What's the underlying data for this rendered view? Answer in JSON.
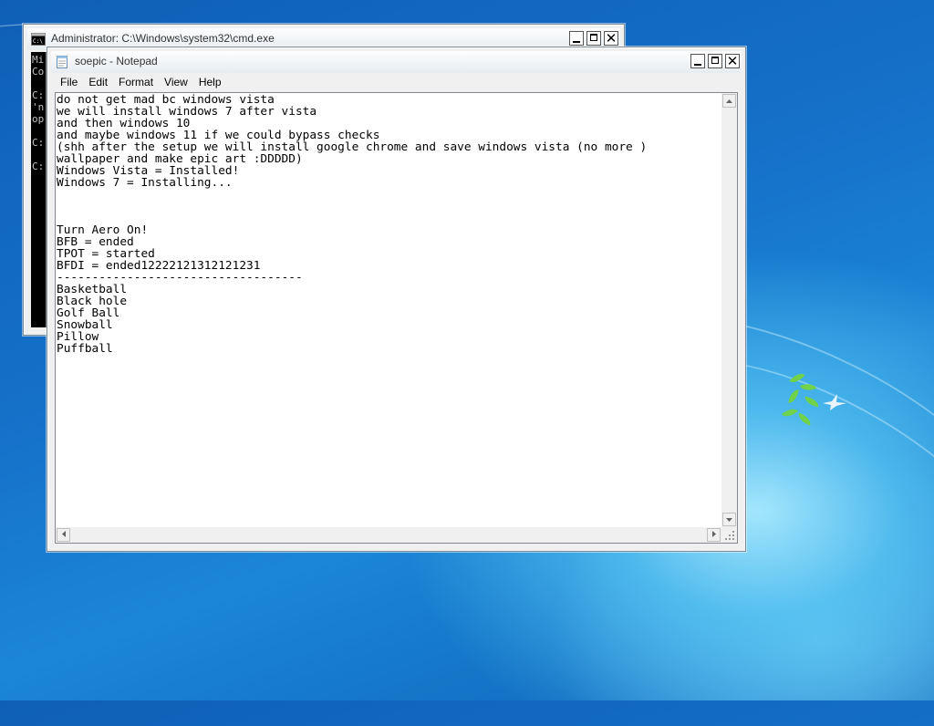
{
  "cmd": {
    "title": "Administrator: C:\\Windows\\system32\\cmd.exe",
    "lines": [
      "Mi",
      "Co",
      "",
      "C:",
      "'n",
      "op",
      "",
      "C:",
      "",
      "C:"
    ]
  },
  "notepad": {
    "title": "soepic - Notepad",
    "menu": [
      "File",
      "Edit",
      "Format",
      "View",
      "Help"
    ],
    "lines": [
      "do not get mad bc windows vista",
      "we will install windows 7 after vista",
      "and then windows 10",
      "and maybe windows 11 if we could bypass checks",
      "(shh after the setup we will install google chrome and save windows vista (no more )",
      "wallpaper and make epic art :DDDDD)",
      "Windows Vista = Installed!",
      "Windows 7 = Installing...",
      "",
      "",
      "",
      "Turn Aero On!",
      "BFB = ended",
      "TPOT = started",
      "BFDI = ended12222121312121231",
      "-----------------------------------",
      "Basketball",
      "Black hole",
      "Golf Ball",
      "Snowball",
      "Pillow",
      "Puffball"
    ]
  },
  "caption": {
    "minimize": "_",
    "maximize": "□",
    "close": "✕"
  },
  "icons": {
    "cmd": "cmd-icon",
    "notepad": "notepad-icon",
    "scroll_up": "arrow-up-icon",
    "scroll_down": "arrow-down-icon",
    "scroll_left": "arrow-left-icon",
    "scroll_right": "arrow-right-icon"
  },
  "colors": {
    "desktop": "#1570c8",
    "console_bg": "#000000",
    "console_fg": "#c0c0c0"
  }
}
